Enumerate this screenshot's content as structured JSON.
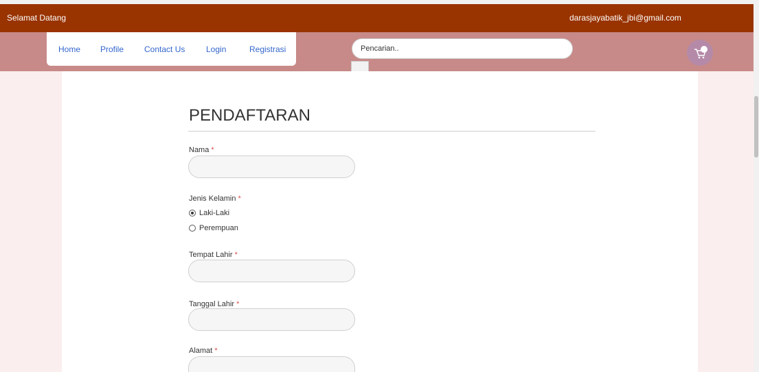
{
  "topbar": {
    "welcome": "Selamat Datang",
    "email": "darasjayabatik_jbi@gmail.com"
  },
  "nav": {
    "items": [
      {
        "label": "Home"
      },
      {
        "label": "Profile"
      },
      {
        "label": "Contact Us"
      },
      {
        "label": "Login"
      },
      {
        "label": "Registrasi"
      }
    ]
  },
  "search": {
    "placeholder": "Pencarian.."
  },
  "cart": {
    "icon": "cart-icon"
  },
  "form": {
    "title": "PENDAFTARAN",
    "required_mark": "*",
    "fields": {
      "nama": "Nama",
      "jenis_kelamin": "Jenis Kelamin",
      "tempat_lahir": "Tempat Lahir",
      "tanggal_lahir": "Tanggal Lahir",
      "alamat": "Alamat"
    },
    "gender_options": [
      "Laki-Laki",
      "Perempuan"
    ],
    "gender_selected": "Laki-Laki"
  },
  "colors": {
    "topbar": "#993300",
    "navband": "#c78a88",
    "link": "#3366cc",
    "required": "#d9534f"
  }
}
